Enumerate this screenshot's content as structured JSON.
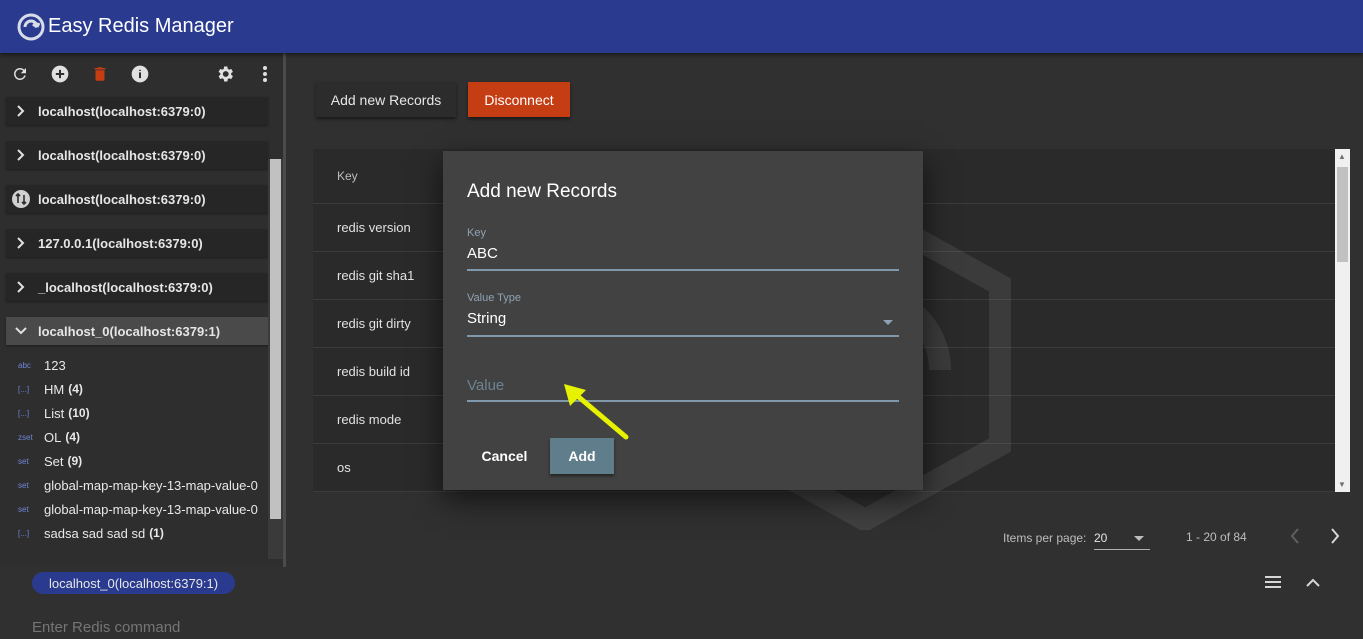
{
  "app": {
    "title": "Easy Redis Manager"
  },
  "sidebar": {
    "toolbar": [
      "refresh-icon",
      "add-circle-icon",
      "delete-icon",
      "info-icon",
      "settings-icon",
      "more-vert-icon"
    ],
    "connections": [
      {
        "label": "localhost(localhost:6379:0)",
        "icon": "chevron-right-icon"
      },
      {
        "label": "localhost(localhost:6379:0)",
        "icon": "chevron-right-icon"
      },
      {
        "label": "localhost(localhost:6379:0)",
        "icon": "swap-icon"
      },
      {
        "label": "127.0.0.1(localhost:6379:0)",
        "icon": "chevron-right-icon"
      },
      {
        "label": "_localhost(localhost:6379:0)",
        "icon": "chevron-right-icon"
      },
      {
        "label": "localhost_0(localhost:6379:1)",
        "icon": "chevron-down-icon"
      }
    ],
    "keys": [
      {
        "type": "abc",
        "name": "123",
        "count": ""
      },
      {
        "type": "[...]",
        "name": "HM",
        "count": "(4)"
      },
      {
        "type": "[...]",
        "name": "List",
        "count": "(10)"
      },
      {
        "type": "zset",
        "name": "OL",
        "count": "(4)"
      },
      {
        "type": "set",
        "name": "Set",
        "count": "(9)"
      },
      {
        "type": "set",
        "name": "global-map-map-key-13-map-value-0",
        "count": ""
      },
      {
        "type": "set",
        "name": "global-map-map-key-13-map-value-0",
        "count": ""
      },
      {
        "type": "[...]",
        "name": "sadsa sad sad sd",
        "count": "(1)"
      }
    ]
  },
  "main": {
    "add_records_label": "Add new Records",
    "disconnect_label": "Disconnect",
    "disconnect_color": "#c53d13",
    "table": {
      "header": "Key",
      "rows": [
        "redis version",
        "redis git sha1",
        "redis git dirty",
        "redis build id",
        "redis mode",
        "os"
      ]
    },
    "pager": {
      "items_per_page_label": "Items per page:",
      "items_per_page": "20",
      "range": "1 - 20 of 84"
    }
  },
  "dialog": {
    "title": "Add new Records",
    "key_label": "Key",
    "key_value": "ABC",
    "type_label": "Value Type",
    "type_value": "String",
    "value_placeholder": "Value",
    "cancel_label": "Cancel",
    "add_label": "Add",
    "add_color": "#607d8b"
  },
  "console": {
    "chip": "localhost_0(localhost:6379:1)",
    "placeholder": "Enter Redis command"
  },
  "colors": {
    "appbar": "#2a3b8f",
    "annotation_arrow": "#e6f200"
  }
}
